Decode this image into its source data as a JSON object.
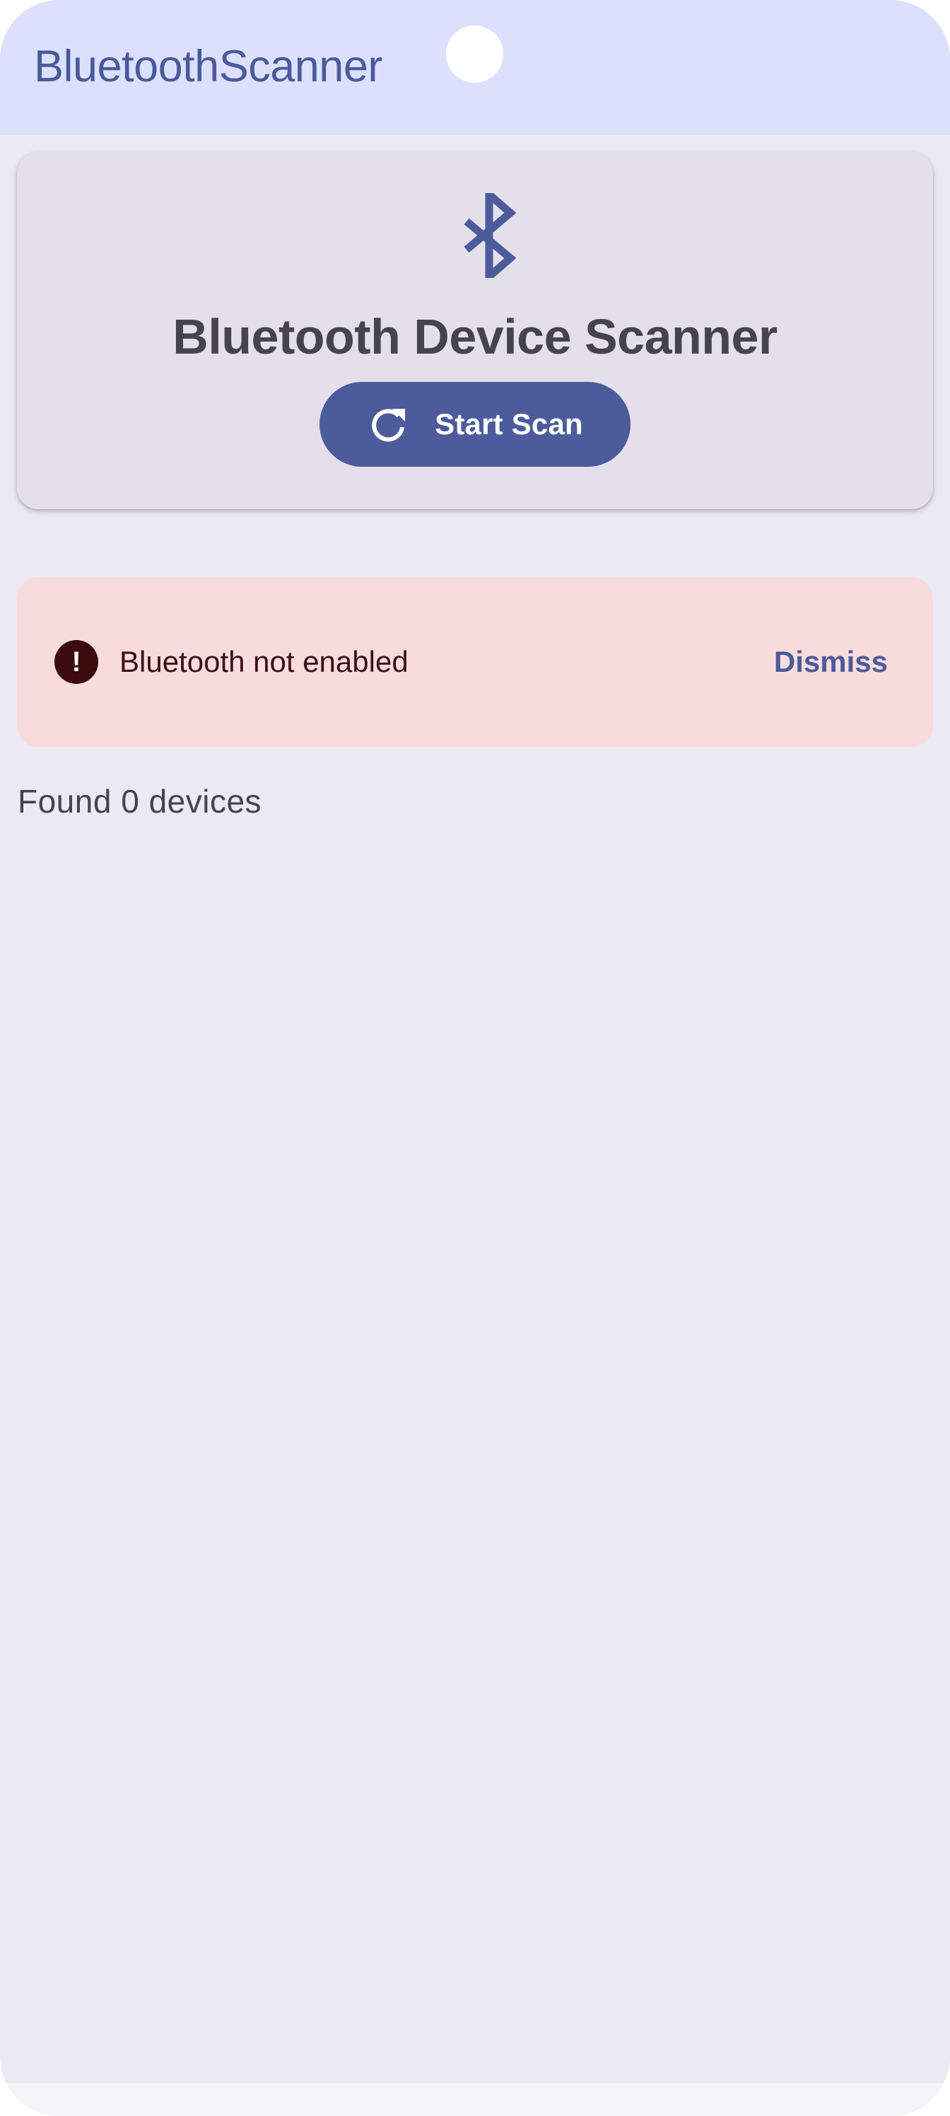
{
  "app_bar": {
    "title": "BluetoothScanner"
  },
  "scanner_card": {
    "icon": "bluetooth-icon",
    "title": "Bluetooth Device Scanner",
    "scan_button": {
      "icon": "refresh-icon",
      "label": "Start Scan"
    }
  },
  "error_banner": {
    "icon": "error-icon",
    "icon_glyph": "!",
    "message": "Bluetooth not enabled",
    "dismiss_label": "Dismiss"
  },
  "device_list": {
    "count_text": "Found 0 devices"
  },
  "colors": {
    "app_bar_bg": "#dce0fd",
    "accent": "#4c5b9b",
    "background": "#ebe9f4",
    "card_bg": "#e3e0ea",
    "error_bg": "#f8dcdc",
    "error_icon": "#3c0b0e"
  }
}
